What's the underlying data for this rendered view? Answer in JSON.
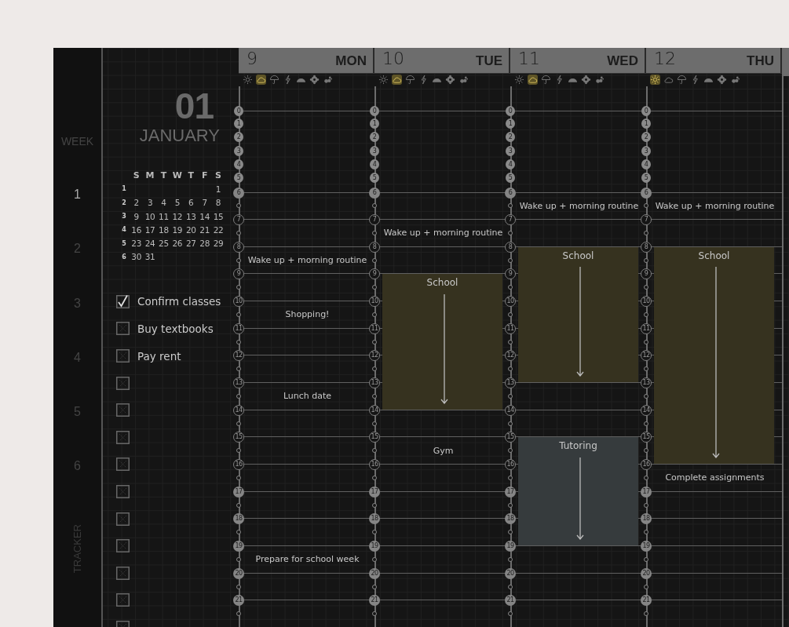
{
  "week_bar": {
    "title": "WEEK",
    "weeks": [
      {
        "label": "1",
        "selected": true
      },
      {
        "label": "2",
        "selected": false
      },
      {
        "label": "3",
        "selected": false
      },
      {
        "label": "4",
        "selected": false
      },
      {
        "label": "5",
        "selected": false
      },
      {
        "label": "6",
        "selected": false
      }
    ],
    "footer": "TRACKER"
  },
  "month": {
    "number": "01",
    "name": "JANUARY"
  },
  "mini_calendar": {
    "weekdays": [
      "S",
      "M",
      "T",
      "W",
      "T",
      "F",
      "S"
    ],
    "weeks": [
      {
        "number": "1",
        "days": [
          {
            "kind": "blank"
          },
          {
            "kind": "blank"
          },
          {
            "kind": "blank"
          },
          {
            "kind": "blank"
          },
          {
            "kind": "blank"
          },
          {
            "kind": "blank"
          },
          {
            "kind": "date",
            "label": "1"
          }
        ]
      },
      {
        "number": "2",
        "days": [
          {
            "kind": "date",
            "label": "2"
          },
          {
            "kind": "date",
            "label": "3"
          },
          {
            "kind": "date",
            "label": "4"
          },
          {
            "kind": "date",
            "label": "5"
          },
          {
            "kind": "date",
            "label": "6"
          },
          {
            "kind": "date",
            "label": "7"
          },
          {
            "kind": "date",
            "label": "8"
          }
        ]
      },
      {
        "number": "3",
        "days": [
          {
            "kind": "date",
            "label": "9"
          },
          {
            "kind": "date",
            "label": "10"
          },
          {
            "kind": "date",
            "label": "11"
          },
          {
            "kind": "date",
            "label": "12"
          },
          {
            "kind": "date",
            "label": "13"
          },
          {
            "kind": "date",
            "label": "14"
          },
          {
            "kind": "date",
            "label": "15"
          }
        ]
      },
      {
        "number": "4",
        "days": [
          {
            "kind": "date",
            "label": "16"
          },
          {
            "kind": "date",
            "label": "17"
          },
          {
            "kind": "date",
            "label": "18"
          },
          {
            "kind": "date",
            "label": "19"
          },
          {
            "kind": "date",
            "label": "20"
          },
          {
            "kind": "date",
            "label": "21"
          },
          {
            "kind": "date",
            "label": "22"
          }
        ]
      },
      {
        "number": "5",
        "days": [
          {
            "kind": "date",
            "label": "23"
          },
          {
            "kind": "date",
            "label": "24"
          },
          {
            "kind": "date",
            "label": "25"
          },
          {
            "kind": "date",
            "label": "26"
          },
          {
            "kind": "date",
            "label": "27"
          },
          {
            "kind": "date",
            "label": "28"
          },
          {
            "kind": "date",
            "label": "29"
          }
        ]
      },
      {
        "number": "6",
        "days": [
          {
            "kind": "date",
            "label": "30"
          },
          {
            "kind": "date",
            "label": "31"
          }
        ]
      }
    ]
  },
  "tasks": [
    {
      "label": "Confirm classes",
      "checked": true
    },
    {
      "label": "Buy textbooks",
      "checked": false
    },
    {
      "label": "Pay rent",
      "checked": false
    },
    {
      "checked": false
    },
    {
      "checked": false
    },
    {
      "checked": false
    },
    {
      "checked": false
    },
    {
      "checked": false
    },
    {
      "checked": false
    },
    {
      "checked": false
    },
    {
      "checked": false
    },
    {
      "checked": false
    },
    {
      "checked": false
    }
  ],
  "days": [
    {
      "number": "9",
      "weekday": "MON",
      "weather": [
        {
          "kind": "sun",
          "selected": false
        },
        {
          "kind": "cloud",
          "selected": true
        },
        {
          "kind": "umbrella",
          "selected": false
        },
        {
          "kind": "lightning",
          "selected": false
        },
        {
          "kind": "rainbow",
          "selected": false
        },
        {
          "kind": "flower",
          "selected": false
        },
        {
          "kind": "wind",
          "selected": false
        }
      ],
      "hours": [
        {
          "label": "0",
          "kind": "early"
        },
        {
          "label": "1",
          "kind": "early"
        },
        {
          "label": "2",
          "kind": "early"
        },
        {
          "label": "3",
          "kind": "early"
        },
        {
          "label": "4",
          "kind": "early"
        },
        {
          "label": "5",
          "kind": "early"
        },
        {
          "label": "6",
          "kind": "night"
        },
        {
          "label": "7",
          "kind": "day"
        },
        {
          "label": "8",
          "kind": "day",
          "note": "Wake up + morning routine"
        },
        {
          "label": "9",
          "kind": "day"
        },
        {
          "label": "10",
          "kind": "day",
          "note": "Shopping!"
        },
        {
          "label": "11",
          "kind": "day"
        },
        {
          "label": "12",
          "kind": "day"
        },
        {
          "label": "13",
          "kind": "day",
          "note": "Lunch date"
        },
        {
          "label": "14",
          "kind": "day"
        },
        {
          "label": "15",
          "kind": "day"
        },
        {
          "label": "16",
          "kind": "day"
        },
        {
          "label": "17",
          "kind": "night"
        },
        {
          "label": "18",
          "kind": "night"
        },
        {
          "label": "19",
          "kind": "night",
          "note": "Prepare for school week"
        },
        {
          "label": "20",
          "kind": "night"
        },
        {
          "label": "21",
          "kind": "night"
        }
      ]
    },
    {
      "number": "10",
      "weekday": "TUE",
      "weather": [
        {
          "kind": "sun",
          "selected": false
        },
        {
          "kind": "cloud",
          "selected": true
        },
        {
          "kind": "umbrella",
          "selected": false
        },
        {
          "kind": "lightning",
          "selected": false
        },
        {
          "kind": "rainbow",
          "selected": false
        },
        {
          "kind": "flower",
          "selected": false
        },
        {
          "kind": "wind",
          "selected": false
        }
      ],
      "hours": [
        {
          "label": "0",
          "kind": "early"
        },
        {
          "label": "1",
          "kind": "early"
        },
        {
          "label": "2",
          "kind": "early"
        },
        {
          "label": "3",
          "kind": "early"
        },
        {
          "label": "4",
          "kind": "early"
        },
        {
          "label": "5",
          "kind": "early"
        },
        {
          "label": "6",
          "kind": "night"
        },
        {
          "label": "7",
          "kind": "day",
          "note": "Wake up + morning routine"
        },
        {
          "label": "8",
          "kind": "day"
        },
        {
          "label": "9",
          "kind": "day",
          "block": {
            "title": "School",
            "color": "#36321f"
          }
        },
        {
          "label": "10",
          "kind": "day",
          "in_block": true
        },
        {
          "label": "11",
          "kind": "day",
          "in_block": true
        },
        {
          "label": "12",
          "kind": "day",
          "in_block": true
        },
        {
          "label": "13",
          "kind": "day",
          "in_block": true
        },
        {
          "label": "14",
          "kind": "day"
        },
        {
          "label": "15",
          "kind": "day",
          "note": "Gym"
        },
        {
          "label": "16",
          "kind": "day"
        },
        {
          "label": "17",
          "kind": "night"
        },
        {
          "label": "18",
          "kind": "night"
        },
        {
          "label": "19",
          "kind": "night"
        },
        {
          "label": "20",
          "kind": "night"
        },
        {
          "label": "21",
          "kind": "night"
        }
      ]
    },
    {
      "number": "11",
      "weekday": "WED",
      "weather": [
        {
          "kind": "sun",
          "selected": false
        },
        {
          "kind": "cloud",
          "selected": true
        },
        {
          "kind": "umbrella",
          "selected": false
        },
        {
          "kind": "lightning",
          "selected": false
        },
        {
          "kind": "rainbow",
          "selected": false
        },
        {
          "kind": "flower",
          "selected": false
        },
        {
          "kind": "wind",
          "selected": false
        }
      ],
      "hours": [
        {
          "label": "0",
          "kind": "early"
        },
        {
          "label": "1",
          "kind": "early"
        },
        {
          "label": "2",
          "kind": "early"
        },
        {
          "label": "3",
          "kind": "early"
        },
        {
          "label": "4",
          "kind": "early"
        },
        {
          "label": "5",
          "kind": "early"
        },
        {
          "label": "6",
          "kind": "night",
          "note": "Wake up + morning routine"
        },
        {
          "label": "7",
          "kind": "day"
        },
        {
          "label": "8",
          "kind": "day",
          "block": {
            "title": "School",
            "color": "#36321f"
          }
        },
        {
          "label": "9",
          "kind": "day",
          "in_block": true
        },
        {
          "label": "10",
          "kind": "day",
          "in_block": true
        },
        {
          "label": "11",
          "kind": "day",
          "in_block": true
        },
        {
          "label": "12",
          "kind": "day",
          "in_block": true
        },
        {
          "label": "13",
          "kind": "day"
        },
        {
          "label": "14",
          "kind": "day"
        },
        {
          "label": "15",
          "kind": "day",
          "block": {
            "title": "Tutoring",
            "color": "#363b3d"
          }
        },
        {
          "label": "16",
          "kind": "day",
          "in_block": true
        },
        {
          "label": "17",
          "kind": "night",
          "in_block": true
        },
        {
          "label": "18",
          "kind": "night",
          "in_block": true
        },
        {
          "label": "19",
          "kind": "night"
        },
        {
          "label": "20",
          "kind": "night"
        },
        {
          "label": "21",
          "kind": "night"
        }
      ]
    },
    {
      "number": "12",
      "weekday": "THU",
      "weather": [
        {
          "kind": "sun",
          "selected": true
        },
        {
          "kind": "cloud",
          "selected": false
        },
        {
          "kind": "umbrella",
          "selected": false
        },
        {
          "kind": "lightning",
          "selected": false
        },
        {
          "kind": "rainbow",
          "selected": false
        },
        {
          "kind": "flower",
          "selected": false
        },
        {
          "kind": "wind",
          "selected": false
        }
      ],
      "hours": [
        {
          "label": "0",
          "kind": "early"
        },
        {
          "label": "1",
          "kind": "early"
        },
        {
          "label": "2",
          "kind": "early"
        },
        {
          "label": "3",
          "kind": "early"
        },
        {
          "label": "4",
          "kind": "early"
        },
        {
          "label": "5",
          "kind": "early"
        },
        {
          "label": "6",
          "kind": "night",
          "note": "Wake up + morning routine"
        },
        {
          "label": "7",
          "kind": "day"
        },
        {
          "label": "8",
          "kind": "day",
          "block": {
            "title": "School",
            "color": "#36321f"
          }
        },
        {
          "label": "9",
          "kind": "day",
          "in_block": true
        },
        {
          "label": "10",
          "kind": "day",
          "in_block": true
        },
        {
          "label": "11",
          "kind": "day",
          "in_block": true
        },
        {
          "label": "12",
          "kind": "day",
          "in_block": true
        },
        {
          "label": "13",
          "kind": "day",
          "in_block": true
        },
        {
          "label": "14",
          "kind": "day",
          "in_block": true
        },
        {
          "label": "15",
          "kind": "day",
          "in_block": true
        },
        {
          "label": "16",
          "kind": "day",
          "note": "Complete assignments"
        },
        {
          "label": "17",
          "kind": "night"
        },
        {
          "label": "18",
          "kind": "night"
        },
        {
          "label": "19",
          "kind": "night"
        },
        {
          "label": "20",
          "kind": "night"
        },
        {
          "label": "21",
          "kind": "night"
        }
      ]
    }
  ]
}
